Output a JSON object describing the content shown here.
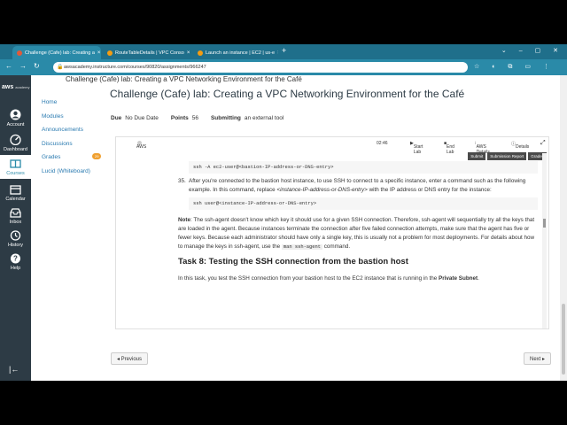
{
  "browser": {
    "tabs": [
      {
        "title": "Challenge (Cafe) lab: Creating a",
        "active": true,
        "favicon_color": "#e05a3a"
      },
      {
        "title": "RouteTableDetails | VPC Conso",
        "active": false,
        "favicon_color": "#f39c12"
      },
      {
        "title": "Launch an instance | EC2 | us-e",
        "active": false,
        "favicon_color": "#f39c12"
      }
    ],
    "new_tab": "+",
    "url": "awsacademy.instructure.com/courses/90820/assignments/966247"
  },
  "global_nav": {
    "logo": "aws",
    "logo_sub": "academy",
    "items": [
      {
        "label": "Account",
        "icon": "account-icon",
        "active": false
      },
      {
        "label": "Dashboard",
        "icon": "dashboard-icon",
        "active": false
      },
      {
        "label": "Courses",
        "icon": "courses-icon",
        "active": true
      },
      {
        "label": "Calendar",
        "icon": "calendar-icon",
        "active": false
      },
      {
        "label": "Inbox",
        "icon": "inbox-icon",
        "active": false
      },
      {
        "label": "History",
        "icon": "history-icon",
        "active": false
      },
      {
        "label": "Help",
        "icon": "help-icon",
        "active": false
      }
    ],
    "collapse_icon": "collapse-icon"
  },
  "breadcrumb": "Challenge (Cafe) lab: Creating a VPC Networking Environment for the Café",
  "course_nav": {
    "items": [
      {
        "label": "Home"
      },
      {
        "label": "Modules"
      },
      {
        "label": "Announcements"
      },
      {
        "label": "Discussions"
      },
      {
        "label": "Grades",
        "badge": "29"
      },
      {
        "label": "Lucid (Whiteboard)"
      }
    ]
  },
  "assignment": {
    "title": "Challenge (Cafe) lab: Creating a VPC Networking Environment for the Café",
    "due_label": "Due",
    "due_value": "No Due Date",
    "points_label": "Points",
    "points_value": "56",
    "submitting_label": "Submitting",
    "submitting_value": "an external tool"
  },
  "lab": {
    "aws_label": "AWS",
    "timer": "02:46",
    "start_lab": "Start Lab",
    "end_lab": "End Lab",
    "aws_details": "AWS Details",
    "details": "Details",
    "buttons": [
      "Submit",
      "Submission Report",
      "Grades"
    ],
    "code1": "ssh -A ec2-user@<bastion-IP-address-or-DNS-entry>",
    "step35_num": "35.",
    "step35_a": "After you're connected to the bastion host instance, to use SSH to connect to a specific instance, enter a command such as the following example. In this command, replace ",
    "step35_em": "<instance-IP-address-or-DNS-entry>",
    "step35_b": " with the IP address or DNS entry for the instance:",
    "code2": "ssh user@<instance-IP-address-or-DNS-entry>",
    "note_label": "Note",
    "note_text": ": The ssh-agent doesn't know which key it should use for a given SSH connection. Therefore, ssh-agent will sequentially try all the keys that are loaded in the agent. Because instances terminate the connection after five failed connection attempts, make sure that the agent has five or fewer keys. Because each administrator should have only a single key, this is usually not a problem for most deployments. For details about how to manage the keys in ssh-agent, use the ",
    "note_code": "man ssh-agent",
    "note_end": " command.",
    "task_heading": "Task 8: Testing the SSH connection from the bastion host",
    "task_text": "In this task, you test the SSH connection from your bastion host to the EC2 instance that is running in the ",
    "task_bold": "Private Subnet",
    "task_end": "."
  },
  "pager": {
    "previous": "◂ Previous",
    "next": "Next ▸"
  }
}
